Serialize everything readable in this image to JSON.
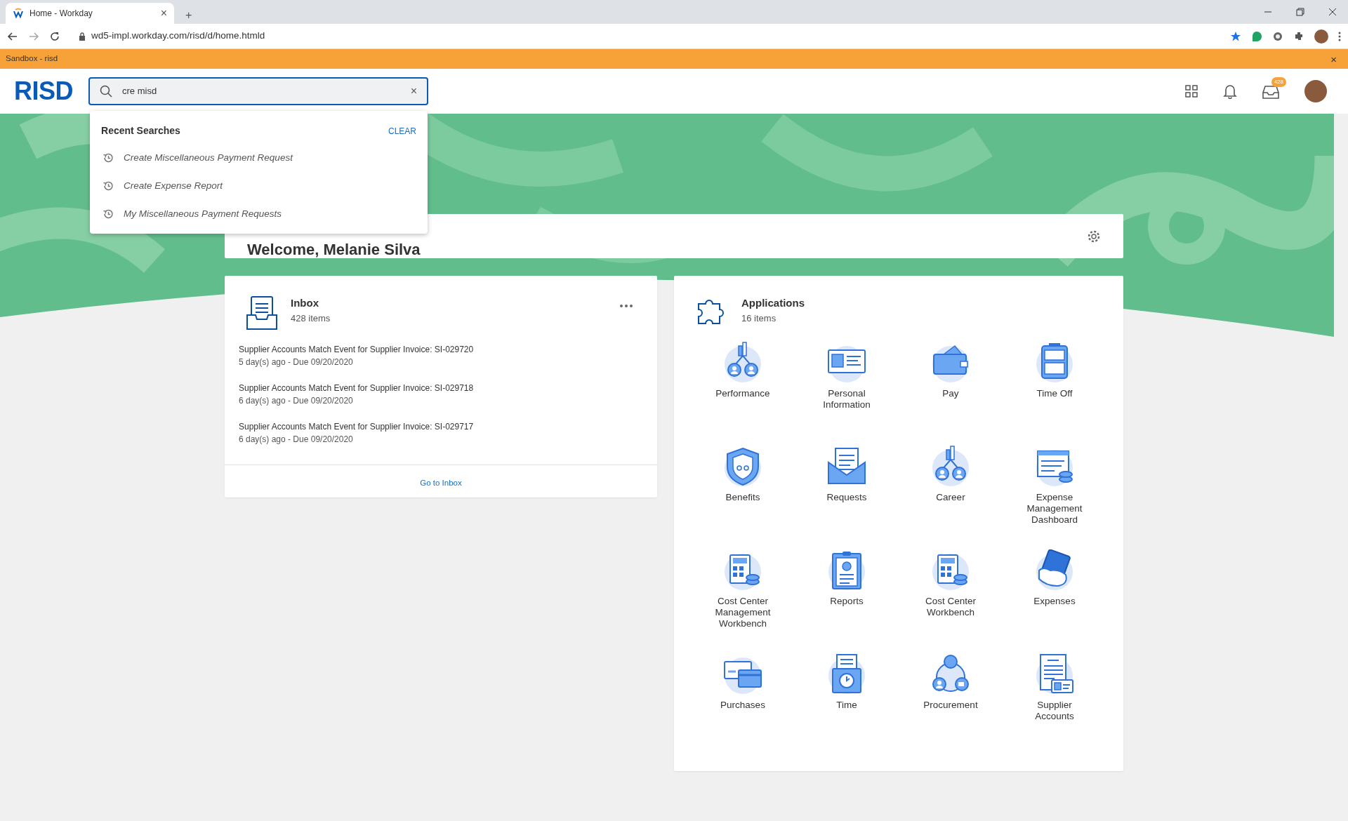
{
  "browser": {
    "tab": {
      "title": "Home - Workday",
      "close": "×"
    },
    "new_tab": "+",
    "url": "wd5-impl.workday.com/risd/d/home.htmld"
  },
  "banner": {
    "text": "Sandbox - risd",
    "close": "×"
  },
  "header": {
    "logo": "RISD",
    "search": {
      "value": "cre misd",
      "clear": "×"
    },
    "inbox_badge": "428"
  },
  "search_dropdown": {
    "title": "Recent Searches",
    "clear": "CLEAR",
    "items": [
      "Create Miscellaneous Payment Request",
      "Create Expense Report",
      "My Miscellaneous Payment Requests"
    ]
  },
  "welcome": {
    "title": "Welcome, Melanie Silva"
  },
  "inbox": {
    "title": "Inbox",
    "count": "428 items",
    "items": [
      {
        "title": "Supplier Accounts Match Event for Supplier Invoice: SI-029720",
        "meta": "5 day(s) ago - Due 09/20/2020"
      },
      {
        "title": "Supplier Accounts Match Event for Supplier Invoice: SI-029718",
        "meta": "6 day(s) ago - Due 09/20/2020"
      },
      {
        "title": "Supplier Accounts Match Event for Supplier Invoice: SI-029717",
        "meta": "6 day(s) ago - Due 09/20/2020"
      }
    ],
    "footer": "Go to Inbox"
  },
  "applications": {
    "title": "Applications",
    "count": "16 items",
    "items": [
      {
        "label": "Performance"
      },
      {
        "label": "Personal Information"
      },
      {
        "label": "Pay"
      },
      {
        "label": "Time Off"
      },
      {
        "label": "Benefits"
      },
      {
        "label": "Requests"
      },
      {
        "label": "Career"
      },
      {
        "label": "Expense Management Dashboard"
      },
      {
        "label": "Cost Center Management Workbench"
      },
      {
        "label": "Reports"
      },
      {
        "label": "Cost Center Workbench"
      },
      {
        "label": "Expenses"
      },
      {
        "label": "Purchases"
      },
      {
        "label": "Time"
      },
      {
        "label": "Procurement"
      },
      {
        "label": "Supplier Accounts"
      }
    ]
  }
}
